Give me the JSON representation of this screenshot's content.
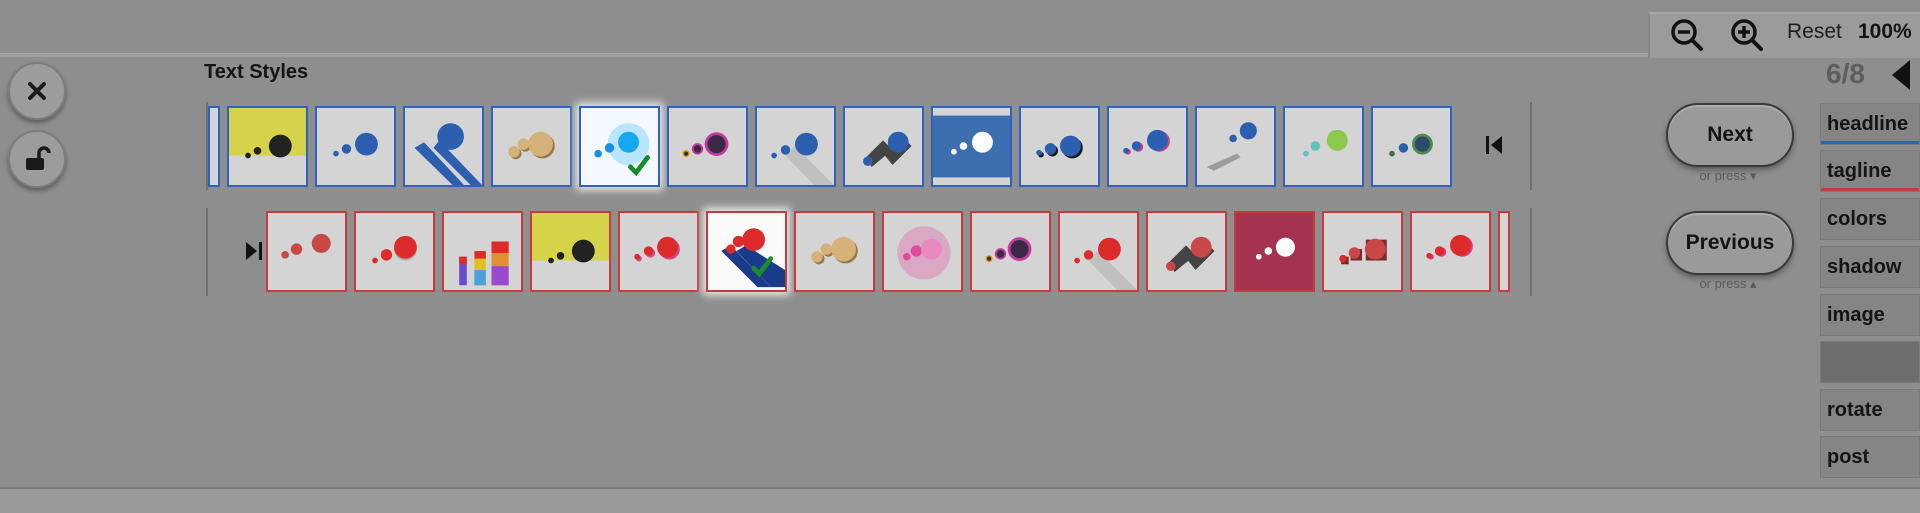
{
  "left_controls": {
    "close_icon": "close-x-icon",
    "lock_icon": "unlocked-padlock-icon"
  },
  "section": {
    "title": "Text Styles"
  },
  "blue_row": {
    "accent": "#2d62c4",
    "tiles": [
      {
        "style": "yellow-dots"
      },
      {
        "style": "blue-dots"
      },
      {
        "style": "blue-diagonal"
      },
      {
        "style": "tan-3d"
      },
      {
        "style": "glow-selected",
        "selected": true
      },
      {
        "style": "multicolor-outline"
      },
      {
        "style": "blue-shadow"
      },
      {
        "style": "dark-long-shadow"
      },
      {
        "style": "dark-blue-bg"
      },
      {
        "style": "blue-offset"
      },
      {
        "style": "pink-shadow"
      },
      {
        "style": "blurred-shadow"
      },
      {
        "style": "green-dots"
      },
      {
        "style": "teal-dark-dots"
      }
    ]
  },
  "red_row": {
    "accent": "#c63c3c",
    "tiles": [
      {
        "style": "red-dots"
      },
      {
        "style": "red-shadow"
      },
      {
        "style": "rainbow-bars"
      },
      {
        "style": "yellow-dots"
      },
      {
        "style": "red-outline"
      },
      {
        "style": "red-blue-diagonal-selected",
        "selected": true
      },
      {
        "style": "tan-3d"
      },
      {
        "style": "pink-glow"
      },
      {
        "style": "multicolor-outline"
      },
      {
        "style": "red-long-shadow"
      },
      {
        "style": "dark-red-long"
      },
      {
        "style": "dark-red-bg"
      },
      {
        "style": "red-block"
      },
      {
        "style": "red-offset"
      }
    ]
  },
  "navigation": {
    "next_label": "Next",
    "next_hint": "or press ▾",
    "previous_label": "Previous",
    "previous_hint": "or press ▴"
  },
  "zoom": {
    "zoom_out_icon": "zoom-out-icon",
    "zoom_in_icon": "zoom-in-icon",
    "reset_label": "Reset",
    "value": "100%"
  },
  "pager": {
    "current": "6",
    "separator": "/",
    "total": "8"
  },
  "menu": {
    "items": [
      {
        "label": "headline",
        "accent": "#2d62c4"
      },
      {
        "label": "tagline",
        "accent": "#c63c3c"
      },
      {
        "label": "colors"
      },
      {
        "label": "shadow"
      },
      {
        "label": "image"
      },
      {
        "label": ""
      },
      {
        "label": "rotate"
      },
      {
        "label": "post"
      }
    ]
  }
}
